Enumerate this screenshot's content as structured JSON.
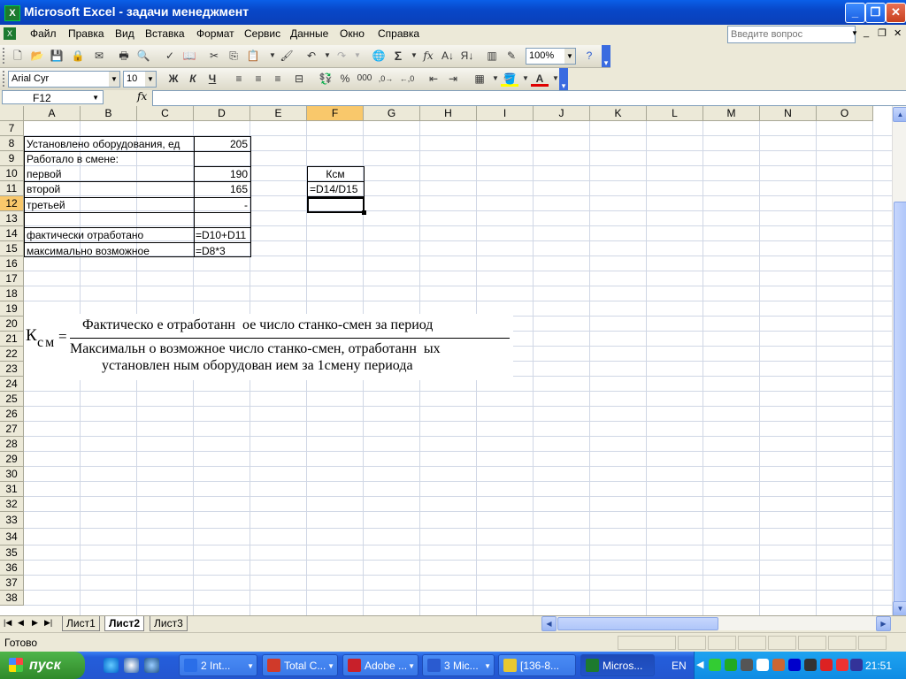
{
  "window": {
    "title": "Microsoft Excel - задачи менеджмент"
  },
  "menu": {
    "items": [
      "Файл",
      "Правка",
      "Вид",
      "Вставка",
      "Формат",
      "Сервис",
      "Данные",
      "Окно",
      "Справка"
    ],
    "ask_placeholder": "Введите вопрос"
  },
  "toolbar": {
    "zoom": "100%",
    "font_name": "Arial Cyr",
    "font_size": "10",
    "bold_label": "Ж",
    "italic_label": "К",
    "underline_label": "Ч",
    "percent_label": "%",
    "thousands_label": "000",
    "sum_label": "Σ",
    "fx_label": "fx"
  },
  "formula_bar": {
    "name_box": "F12",
    "fx": "fx",
    "formula": ""
  },
  "columns": [
    "A",
    "B",
    "C",
    "D",
    "E",
    "F",
    "G",
    "H",
    "I",
    "J",
    "K",
    "L",
    "M",
    "N",
    "O"
  ],
  "selected_column": "F",
  "rows": [
    "7",
    "8",
    "9",
    "10",
    "11",
    "12",
    "13",
    "14",
    "15",
    "16",
    "17",
    "18",
    "19",
    "20",
    "21",
    "22",
    "23",
    "24",
    "25",
    "26",
    "27",
    "28",
    "29",
    "30",
    "31",
    "32",
    "33",
    "34",
    "35",
    "36",
    "37",
    "38"
  ],
  "selected_row": "12",
  "cells": {
    "A8": "Установлено оборудования, ед",
    "D8": "205",
    "A9": "Работало в смене:",
    "A10": "первой",
    "D10": "190",
    "A11": "второй",
    "D11": "165",
    "A12": "третьей",
    "D12": "-",
    "A14": "фактически отработано",
    "D14": "=D10+D11",
    "A15": "максимально возможное",
    "D15": "=D8*3",
    "F10": "Ксм",
    "F11": "=D14/D15"
  },
  "formula_image": {
    "lhs_main": "К",
    "lhs_sub": "см",
    "equals": "=",
    "numerator": "Фактическо е отработанн  ое число станко-смен за период",
    "denominator_line1": "Максимальн о возможное число станко-смен, отработанн  ых",
    "denominator_line2": "установлен ным оборудован ием за 1смену периода"
  },
  "sheet_tabs": [
    "Лист1",
    "Лист2",
    "Лист3"
  ],
  "active_sheet": "Лист2",
  "status": {
    "text": "Готово"
  },
  "taskbar": {
    "start_label": "пуск",
    "buttons": [
      {
        "label": "2 Int...",
        "color": "#2a6ee8"
      },
      {
        "label": "Total C...",
        "color": "#d03a2a"
      },
      {
        "label": "Adobe ...",
        "color": "#c8202a"
      },
      {
        "label": "3 Mic...",
        "color": "#2a5bd0"
      },
      {
        "label": "[136-8...",
        "color": "#e8c830"
      },
      {
        "label": "Micros...",
        "color": "#1d7a2f"
      }
    ],
    "language": "EN",
    "clock": "21:51"
  }
}
